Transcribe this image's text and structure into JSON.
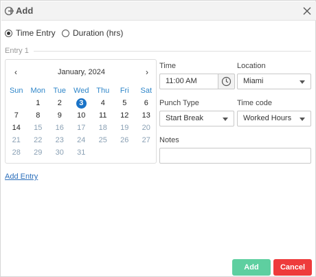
{
  "dialog": {
    "title": "Add"
  },
  "mode": {
    "options": [
      {
        "label": "Time Entry",
        "selected": true
      },
      {
        "label": "Duration (hrs)",
        "selected": false
      }
    ]
  },
  "entry": {
    "section_label": "Entry 1"
  },
  "calendar": {
    "title": "January, 2024",
    "prev_symbol": "‹",
    "next_symbol": "›",
    "weekdays": [
      "Sun",
      "Mon",
      "Tue",
      "Wed",
      "Thu",
      "Fri",
      "Sat"
    ],
    "weeks": [
      [
        "",
        "1",
        "2",
        "3",
        "4",
        "5",
        "6"
      ],
      [
        "7",
        "8",
        "9",
        "10",
        "11",
        "12",
        "13"
      ],
      [
        "14",
        "15",
        "16",
        "17",
        "18",
        "19",
        "20"
      ],
      [
        "21",
        "22",
        "23",
        "24",
        "25",
        "26",
        "27"
      ],
      [
        "28",
        "29",
        "30",
        "31",
        "",
        "",
        ""
      ]
    ],
    "selected_day": "3",
    "enabled_through": "14"
  },
  "fields": {
    "time": {
      "label": "Time",
      "value": "11:00 AM"
    },
    "location": {
      "label": "Location",
      "value": "Miami"
    },
    "punch_type": {
      "label": "Punch Type",
      "value": "Start Break"
    },
    "time_code": {
      "label": "Time code",
      "value": "Worked Hours"
    },
    "notes": {
      "label": "Notes",
      "value": ""
    }
  },
  "add_entry_link": "Add Entry",
  "buttons": {
    "add": "Add",
    "cancel": "Cancel"
  },
  "colors": {
    "selected_day": "#1a73c7",
    "add": "#5ecfa0",
    "cancel": "#ee3b3b",
    "weekday": "#2f86c9"
  },
  "icons": {
    "title": "add-circle-icon",
    "close": "close-icon",
    "clock": "clock-icon",
    "dropdown": "caret-down-icon"
  }
}
